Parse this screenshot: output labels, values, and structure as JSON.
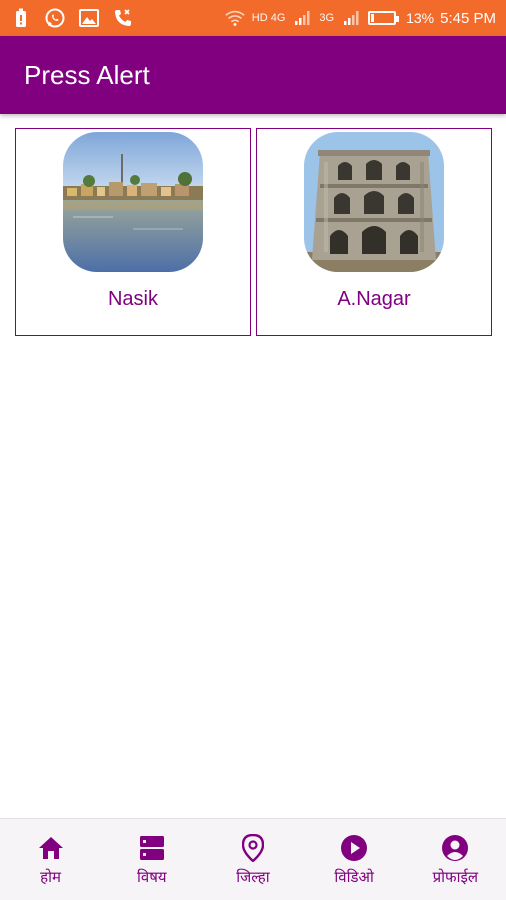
{
  "status_bar": {
    "network_hd": "HD 4G",
    "network_3g": "3G",
    "battery": "13%",
    "time": "5:45 PM",
    "background": "#F26B2B"
  },
  "app_bar": {
    "title": "Press Alert",
    "background": "#800080"
  },
  "districts": [
    {
      "label": "Nasik",
      "image_icon": "river-town-photo"
    },
    {
      "label": "A.Nagar",
      "image_icon": "fort-tower-photo"
    }
  ],
  "bottom_nav": {
    "items": [
      {
        "label": "होम",
        "icon": "home-icon"
      },
      {
        "label": "विषय",
        "icon": "category-icon"
      },
      {
        "label": "जिल्हा",
        "icon": "location-pin-icon"
      },
      {
        "label": "विडिओ",
        "icon": "play-circle-icon"
      },
      {
        "label": "प्रोफाईल",
        "icon": "account-circle-icon"
      }
    ],
    "accent": "#800080"
  }
}
